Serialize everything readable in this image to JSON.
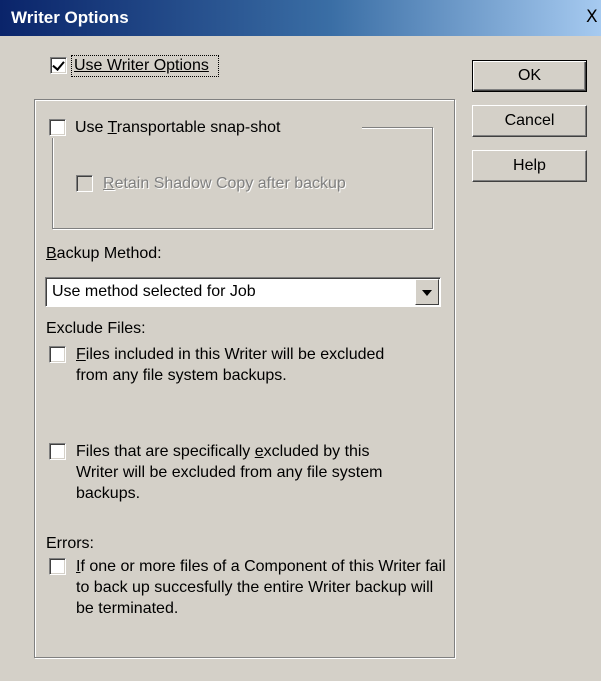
{
  "window": {
    "title": "Writer Options",
    "close_glyph": "X"
  },
  "use_writer_options": {
    "label": "Use Writer Options",
    "checked": true
  },
  "buttons": {
    "ok": "OK",
    "cancel": "Cancel",
    "help": "Help"
  },
  "transportable": {
    "label_prefix": "Use ",
    "label_underlined": "T",
    "label_rest": "ransportable snap-shot",
    "checked": false
  },
  "retain_shadow": {
    "label_underlined": "R",
    "label_rest": "etain Shadow Copy after backup",
    "checked": false,
    "disabled": true
  },
  "backup_method": {
    "label_underlined": "B",
    "label_rest": "ackup Method:",
    "selected": "Use method selected for Job"
  },
  "exclude_files": {
    "heading": "Exclude Files:",
    "option1_underlined": "F",
    "option1_rest": "iles included in this Writer will be excluded from any file system backups.",
    "option2_prefix": "Files that are specifically ",
    "option2_underlined": "e",
    "option2_rest": "xcluded by this Writer will be excluded from any file system backups."
  },
  "errors": {
    "heading": "Errors:",
    "option_underlined": "I",
    "option_rest": "f one or more files of a Component of this Writer fail to back up succesfully the entire Writer backup will be terminated."
  },
  "icons": {
    "close": "close-icon",
    "dropdown": "chevron-down-icon",
    "checkmark": "checkmark-icon"
  }
}
